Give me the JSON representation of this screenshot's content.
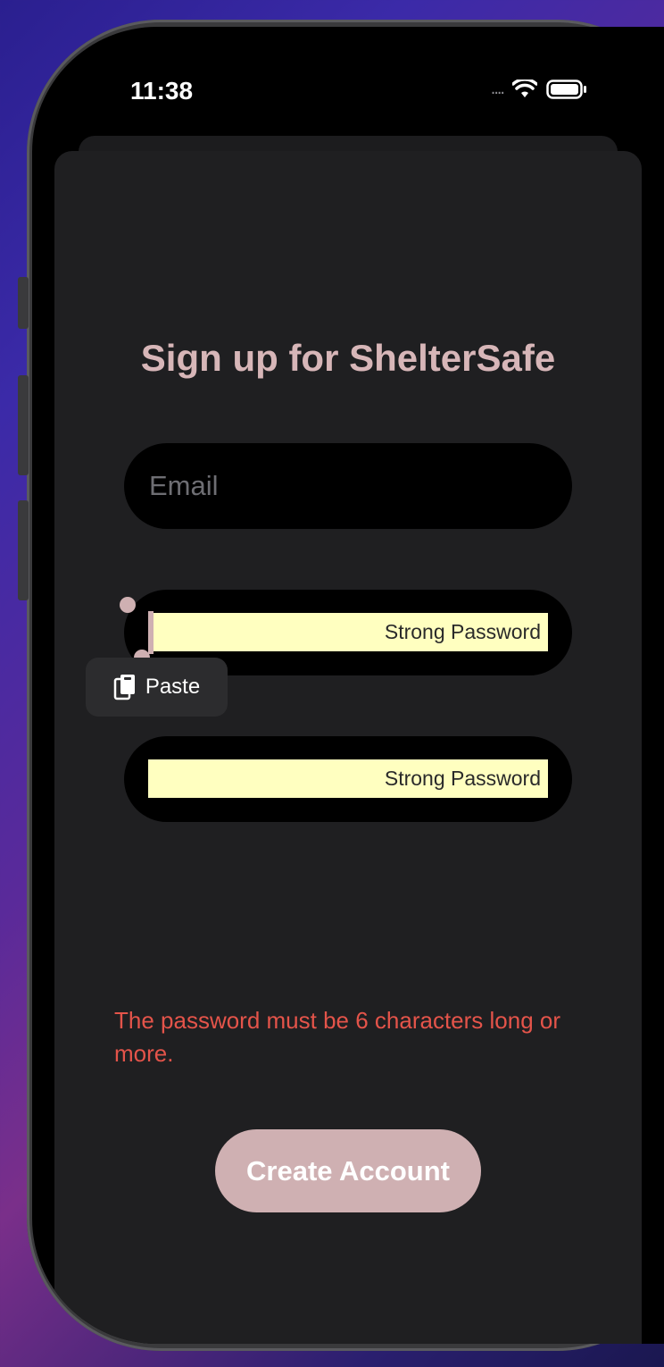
{
  "status_bar": {
    "time": "11:38",
    "signal": "....",
    "wifi_icon": "wifi-icon",
    "battery_icon": "battery-icon"
  },
  "page": {
    "title": "Sign up for ShelterSafe"
  },
  "email": {
    "placeholder": "Email"
  },
  "password": {
    "autofill_label": "Strong Password",
    "cursor_char": "2"
  },
  "confirm_password": {
    "autofill_label": "Strong Password",
    "cursor_char": "2"
  },
  "context_menu": {
    "paste_label": "Paste",
    "paste_icon": "clipboard-icon"
  },
  "error": {
    "message": "The password must be 6 characters long or more."
  },
  "actions": {
    "create_account": "Create Account"
  },
  "colors": {
    "accent": "#cfb0b2",
    "title": "#d7b6b8",
    "error": "#e4544a",
    "autofill_bg": "#ffffc0",
    "sheet_bg": "#1f1f21"
  }
}
